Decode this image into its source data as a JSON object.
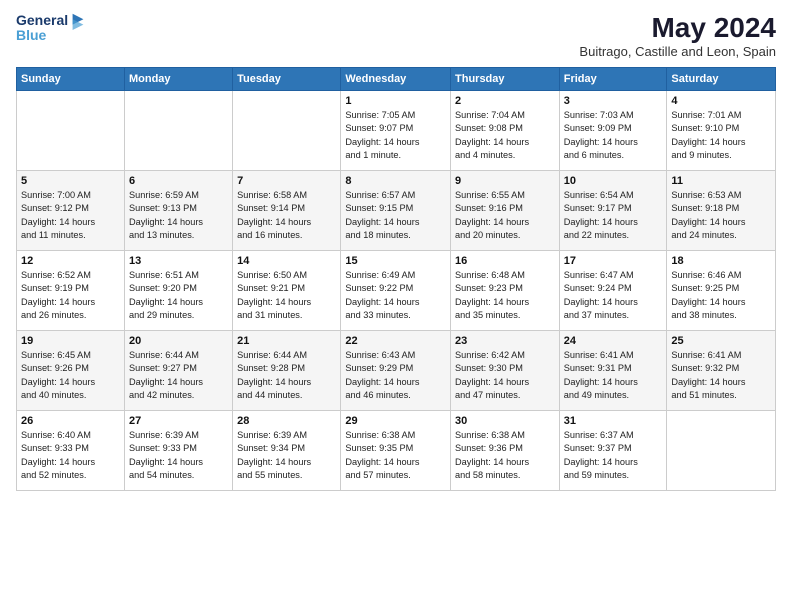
{
  "header": {
    "logo_line1": "General",
    "logo_line2": "Blue",
    "title": "May 2024",
    "subtitle": "Buitrago, Castille and Leon, Spain"
  },
  "weekdays": [
    "Sunday",
    "Monday",
    "Tuesday",
    "Wednesday",
    "Thursday",
    "Friday",
    "Saturday"
  ],
  "weeks": [
    [
      {
        "day": "",
        "info": ""
      },
      {
        "day": "",
        "info": ""
      },
      {
        "day": "",
        "info": ""
      },
      {
        "day": "1",
        "info": "Sunrise: 7:05 AM\nSunset: 9:07 PM\nDaylight: 14 hours\nand 1 minute."
      },
      {
        "day": "2",
        "info": "Sunrise: 7:04 AM\nSunset: 9:08 PM\nDaylight: 14 hours\nand 4 minutes."
      },
      {
        "day": "3",
        "info": "Sunrise: 7:03 AM\nSunset: 9:09 PM\nDaylight: 14 hours\nand 6 minutes."
      },
      {
        "day": "4",
        "info": "Sunrise: 7:01 AM\nSunset: 9:10 PM\nDaylight: 14 hours\nand 9 minutes."
      }
    ],
    [
      {
        "day": "5",
        "info": "Sunrise: 7:00 AM\nSunset: 9:12 PM\nDaylight: 14 hours\nand 11 minutes."
      },
      {
        "day": "6",
        "info": "Sunrise: 6:59 AM\nSunset: 9:13 PM\nDaylight: 14 hours\nand 13 minutes."
      },
      {
        "day": "7",
        "info": "Sunrise: 6:58 AM\nSunset: 9:14 PM\nDaylight: 14 hours\nand 16 minutes."
      },
      {
        "day": "8",
        "info": "Sunrise: 6:57 AM\nSunset: 9:15 PM\nDaylight: 14 hours\nand 18 minutes."
      },
      {
        "day": "9",
        "info": "Sunrise: 6:55 AM\nSunset: 9:16 PM\nDaylight: 14 hours\nand 20 minutes."
      },
      {
        "day": "10",
        "info": "Sunrise: 6:54 AM\nSunset: 9:17 PM\nDaylight: 14 hours\nand 22 minutes."
      },
      {
        "day": "11",
        "info": "Sunrise: 6:53 AM\nSunset: 9:18 PM\nDaylight: 14 hours\nand 24 minutes."
      }
    ],
    [
      {
        "day": "12",
        "info": "Sunrise: 6:52 AM\nSunset: 9:19 PM\nDaylight: 14 hours\nand 26 minutes."
      },
      {
        "day": "13",
        "info": "Sunrise: 6:51 AM\nSunset: 9:20 PM\nDaylight: 14 hours\nand 29 minutes."
      },
      {
        "day": "14",
        "info": "Sunrise: 6:50 AM\nSunset: 9:21 PM\nDaylight: 14 hours\nand 31 minutes."
      },
      {
        "day": "15",
        "info": "Sunrise: 6:49 AM\nSunset: 9:22 PM\nDaylight: 14 hours\nand 33 minutes."
      },
      {
        "day": "16",
        "info": "Sunrise: 6:48 AM\nSunset: 9:23 PM\nDaylight: 14 hours\nand 35 minutes."
      },
      {
        "day": "17",
        "info": "Sunrise: 6:47 AM\nSunset: 9:24 PM\nDaylight: 14 hours\nand 37 minutes."
      },
      {
        "day": "18",
        "info": "Sunrise: 6:46 AM\nSunset: 9:25 PM\nDaylight: 14 hours\nand 38 minutes."
      }
    ],
    [
      {
        "day": "19",
        "info": "Sunrise: 6:45 AM\nSunset: 9:26 PM\nDaylight: 14 hours\nand 40 minutes."
      },
      {
        "day": "20",
        "info": "Sunrise: 6:44 AM\nSunset: 9:27 PM\nDaylight: 14 hours\nand 42 minutes."
      },
      {
        "day": "21",
        "info": "Sunrise: 6:44 AM\nSunset: 9:28 PM\nDaylight: 14 hours\nand 44 minutes."
      },
      {
        "day": "22",
        "info": "Sunrise: 6:43 AM\nSunset: 9:29 PM\nDaylight: 14 hours\nand 46 minutes."
      },
      {
        "day": "23",
        "info": "Sunrise: 6:42 AM\nSunset: 9:30 PM\nDaylight: 14 hours\nand 47 minutes."
      },
      {
        "day": "24",
        "info": "Sunrise: 6:41 AM\nSunset: 9:31 PM\nDaylight: 14 hours\nand 49 minutes."
      },
      {
        "day": "25",
        "info": "Sunrise: 6:41 AM\nSunset: 9:32 PM\nDaylight: 14 hours\nand 51 minutes."
      }
    ],
    [
      {
        "day": "26",
        "info": "Sunrise: 6:40 AM\nSunset: 9:33 PM\nDaylight: 14 hours\nand 52 minutes."
      },
      {
        "day": "27",
        "info": "Sunrise: 6:39 AM\nSunset: 9:33 PM\nDaylight: 14 hours\nand 54 minutes."
      },
      {
        "day": "28",
        "info": "Sunrise: 6:39 AM\nSunset: 9:34 PM\nDaylight: 14 hours\nand 55 minutes."
      },
      {
        "day": "29",
        "info": "Sunrise: 6:38 AM\nSunset: 9:35 PM\nDaylight: 14 hours\nand 57 minutes."
      },
      {
        "day": "30",
        "info": "Sunrise: 6:38 AM\nSunset: 9:36 PM\nDaylight: 14 hours\nand 58 minutes."
      },
      {
        "day": "31",
        "info": "Sunrise: 6:37 AM\nSunset: 9:37 PM\nDaylight: 14 hours\nand 59 minutes."
      },
      {
        "day": "",
        "info": ""
      }
    ]
  ]
}
